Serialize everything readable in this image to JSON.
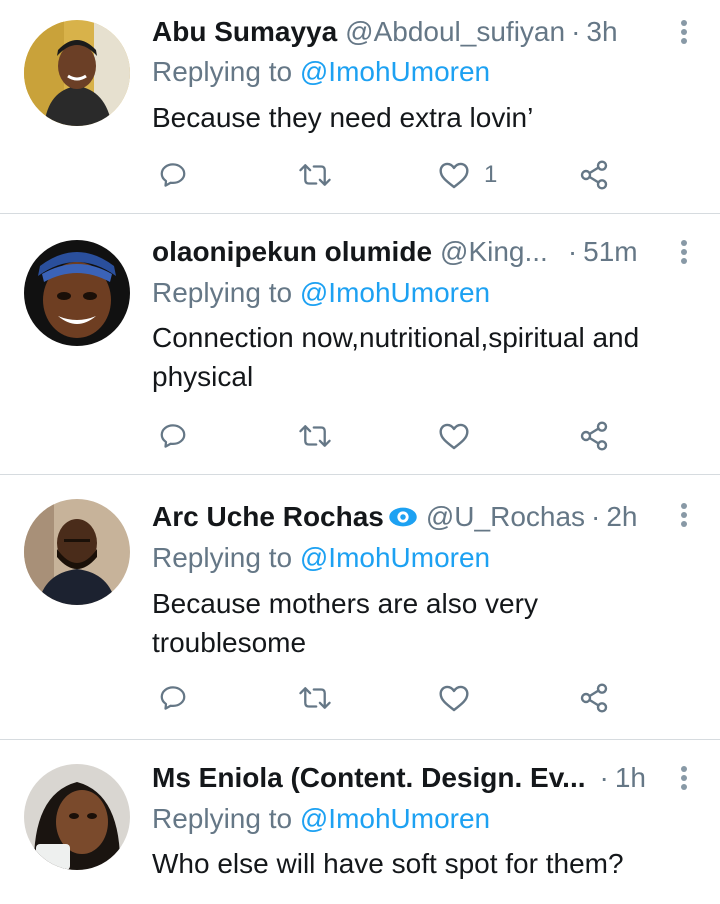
{
  "tweets": [
    {
      "name": "Abu Sumayya",
      "handle": "@Abdoul_sufiyan",
      "time": "3h",
      "replying_prefix": "Replying to",
      "replying_to": "@ImohUmoren",
      "text": "Because they need extra lovin’",
      "likes": "1"
    },
    {
      "name": "olaonipekun olumide",
      "handle": "@King...",
      "time": "51m",
      "replying_prefix": "Replying to",
      "replying_to": "@ImohUmoren",
      "text": "Connection now,nutritional,spiritual and physical",
      "likes": ""
    },
    {
      "name": "Arc Uche Rochas",
      "handle": "@U_Rochas",
      "time": "2h",
      "replying_prefix": "Replying to",
      "replying_to": "@ImohUmoren",
      "text": "Because mothers are also very troublesome",
      "likes": ""
    },
    {
      "name": "Ms Eniola (Content. Design. Ev...",
      "handle": "",
      "time": "1h",
      "replying_prefix": "Replying to",
      "replying_to": "@ImohUmoren",
      "text": "Who else will have soft spot for them?",
      "likes": ""
    }
  ],
  "separator": "·",
  "icons": {
    "reply": "reply-icon",
    "retweet": "retweet-icon",
    "like": "heart-icon",
    "share": "share-icon",
    "more": "more-vertical-icon",
    "verified": "verified-badge-icon"
  },
  "colors": {
    "link": "#1da1f2",
    "muted": "#657786",
    "text": "#14171a",
    "divider": "#d6dbdf"
  }
}
